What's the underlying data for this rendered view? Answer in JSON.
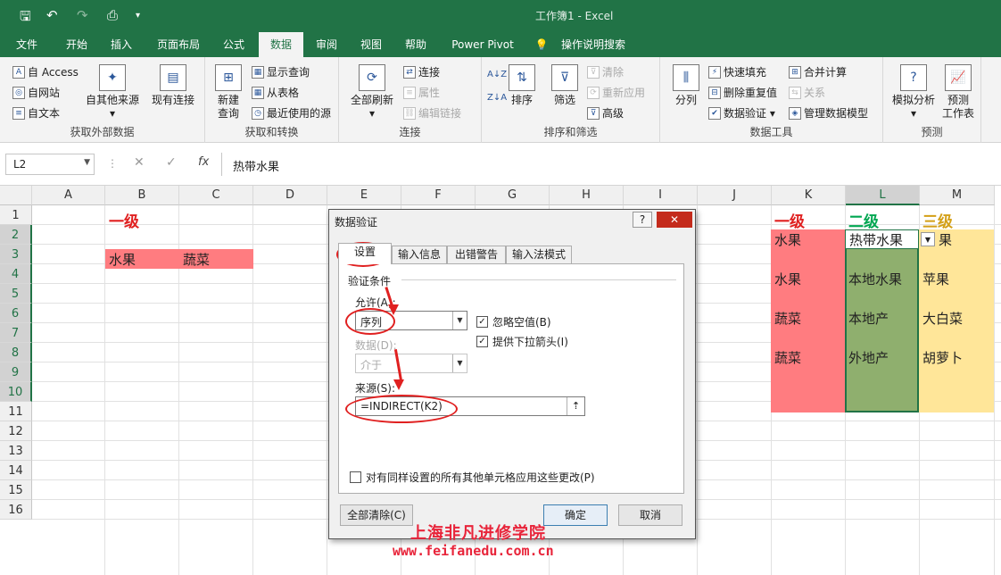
{
  "window": {
    "title": "工作簿1  -  Excel"
  },
  "quick_access": [
    "save-icon",
    "undo-icon",
    "redo-icon",
    "print-preview-icon",
    "customize-icon"
  ],
  "tabs": [
    "文件",
    "开始",
    "插入",
    "页面布局",
    "公式",
    "数据",
    "审阅",
    "视图",
    "帮助",
    "Power Pivot",
    "操作说明搜索"
  ],
  "active_tab": "数据",
  "ribbon": {
    "get_external": {
      "access": "自 Access",
      "web": "自网站",
      "text": "自文本",
      "other": "自其他来源",
      "existing": "现有连接",
      "label": "获取外部数据"
    },
    "get_transform": {
      "new_query": "新建\n查询",
      "show_query": "显示查询",
      "from_table": "从表格",
      "recent": "最近使用的源",
      "label": "获取和转换"
    },
    "connections": {
      "refresh_all": "全部刷新",
      "connections": "连接",
      "properties": "属性",
      "edit_links": "编辑链接",
      "label": "连接"
    },
    "sort_filter": {
      "sort": "排序",
      "filter": "筛选",
      "clear": "清除",
      "reapply": "重新应用",
      "advanced": "高级",
      "label": "排序和筛选"
    },
    "data_tools": {
      "split": "分列",
      "flash_fill": "快速填充",
      "remove_dup": "删除重复值",
      "validation": "数据验证",
      "consolidate": "合并计算",
      "relationships": "关系",
      "manage_model": "管理数据模型",
      "label": "数据工具"
    },
    "forecast": {
      "what_if": "模拟分析",
      "sheet": "预测\n工作表",
      "label": "预测"
    }
  },
  "formula_bar": {
    "name_box": "L2",
    "formula": "热带水果",
    "fx": "fx",
    "cancel": "✕",
    "enter": "✓"
  },
  "columns": [
    "A",
    "B",
    "C",
    "D",
    "E",
    "F",
    "G",
    "H",
    "I",
    "J",
    "K",
    "L",
    "M"
  ],
  "rows": [
    "1",
    "2",
    "3",
    "4",
    "5",
    "6",
    "7",
    "8",
    "9",
    "10",
    "11",
    "12",
    "13",
    "14",
    "15",
    "16"
  ],
  "cells": {
    "B1": "一级",
    "B3": "水果",
    "C3": "蔬菜",
    "K1": "一级",
    "L1": "二级",
    "M1": "三级",
    "K2": "水果",
    "K4": "水果",
    "K6": "蔬菜",
    "K8": "蔬菜",
    "L2": "热带水果",
    "L4": "本地水果",
    "L6": "本地产",
    "L8": "外地产",
    "M2": "果",
    "M4": "苹果",
    "M6": "大白菜",
    "M8": "胡萝卜"
  },
  "colors": {
    "excel_green": "#217346",
    "salmon": "#ff7c80",
    "olive_green": "#8faf6e",
    "pale_yellow": "#ffe699",
    "heading_red": "#e02020",
    "heading_green": "#00a651",
    "heading_gold": "#d4a017"
  },
  "dialog": {
    "title": "数据验证",
    "help": "?",
    "close": "✕",
    "tabs": [
      "设置",
      "输入信息",
      "出错警告",
      "输入法模式"
    ],
    "section": "验证条件",
    "allow_label": "允许(A):",
    "allow_value": "序列",
    "data_label": "数据(D):",
    "data_value": "介于",
    "ignore_blank": "忽略空值(B)",
    "dropdown": "提供下拉箭头(I)",
    "source_label": "来源(S):",
    "source_value": "=INDIRECT(K2)",
    "apply_all": "对有同样设置的所有其他单元格应用这些更改(P)",
    "clear_all": "全部清除(C)",
    "ok": "确定",
    "cancel": "取消"
  },
  "watermark": {
    "line1": "上海非凡进修学院",
    "line2": "www.feifanedu.com.cn"
  }
}
